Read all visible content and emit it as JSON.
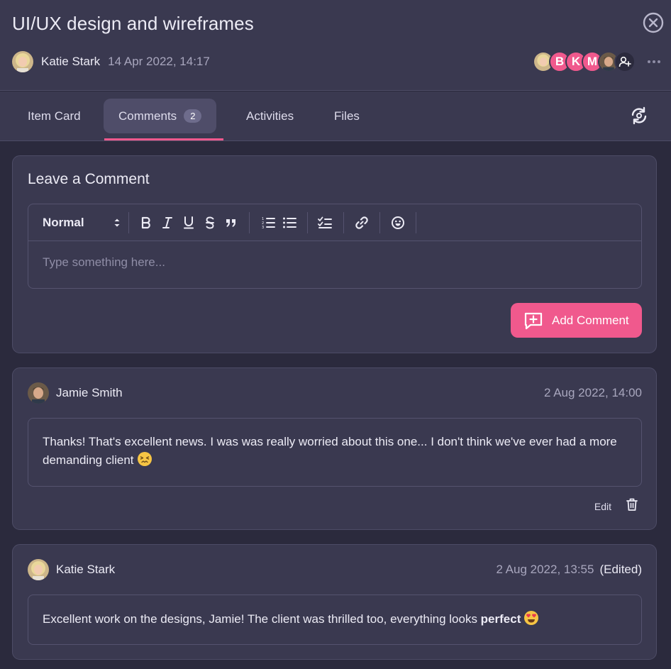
{
  "header": {
    "title": "UI/UX design and wireframes",
    "author": {
      "name": "Katie Stark",
      "date": "14 Apr 2022, 14:17"
    },
    "members": [
      "B",
      "K",
      "M"
    ]
  },
  "tabs": [
    {
      "label": "Item Card"
    },
    {
      "label": "Comments",
      "badge": "2"
    },
    {
      "label": "Activities"
    },
    {
      "label": "Files"
    }
  ],
  "composer": {
    "title": "Leave a Comment",
    "format": "Normal",
    "placeholder": "Type something here...",
    "submit_label": "Add Comment"
  },
  "comments": [
    {
      "author": "Jamie Smith",
      "date": "2 Aug 2022, 14:00",
      "text": "Thanks! That's excellent news. I was was really worried about this one... I don't think we've ever had a more demanding client",
      "emoji": "😣",
      "edit_label": "Edit"
    },
    {
      "author": "Katie Stark",
      "date": "2 Aug 2022, 13:55",
      "edited": "(Edited)",
      "text": "Excellent work on the designs, Jamie! The client was thrilled too, everything looks ",
      "bold": "perfect",
      "emoji": "😍"
    }
  ],
  "colors": {
    "accent": "#f0598d",
    "panel": "#3a3950",
    "background": "#2b2a3d"
  },
  "icons": [
    "close-icon",
    "more-icon",
    "add-member-icon",
    "refresh-icon",
    "bold-icon",
    "italic-icon",
    "underline-icon",
    "strikethrough-icon",
    "quote-icon",
    "ordered-list-icon",
    "bullet-list-icon",
    "checklist-icon",
    "link-icon",
    "emoji-icon",
    "comment-add-icon",
    "trash-icon"
  ]
}
